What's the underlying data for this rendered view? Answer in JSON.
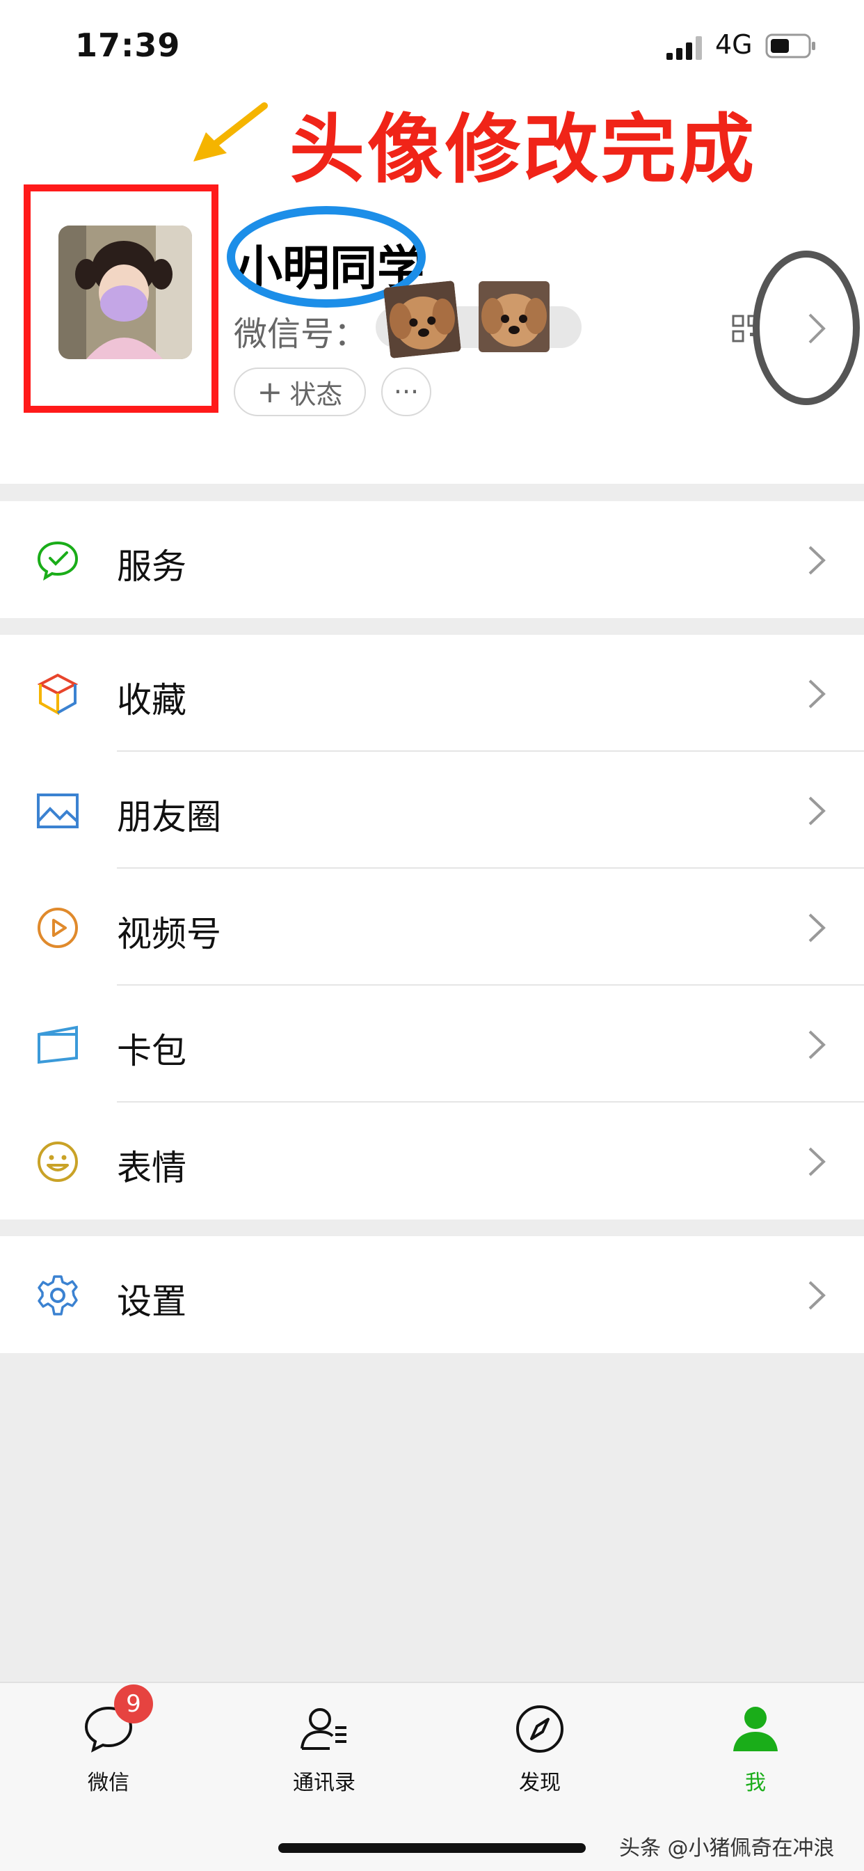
{
  "status_bar": {
    "time": "17:39",
    "network": "4G"
  },
  "annotation": {
    "title": "头像修改完成"
  },
  "profile": {
    "nickname": "小明同学",
    "wechat_id_label": "微信号：",
    "status_button_label": "状态",
    "more_button_label": "···"
  },
  "menu_groups": [
    {
      "items": [
        {
          "label": "服务",
          "icon": "services-icon"
        }
      ]
    },
    {
      "items": [
        {
          "label": "收藏",
          "icon": "favorites-icon"
        },
        {
          "label": "朋友圈",
          "icon": "moments-icon"
        },
        {
          "label": "视频号",
          "icon": "channels-icon"
        },
        {
          "label": "卡包",
          "icon": "card-wallet-icon"
        },
        {
          "label": "表情",
          "icon": "stickers-icon"
        }
      ]
    },
    {
      "items": [
        {
          "label": "设置",
          "icon": "settings-icon"
        }
      ]
    }
  ],
  "tabbar": {
    "tabs": [
      {
        "label": "微信",
        "icon": "chat-icon",
        "badge": "9"
      },
      {
        "label": "通讯录",
        "icon": "contacts-icon"
      },
      {
        "label": "发现",
        "icon": "discover-icon"
      },
      {
        "label": "我",
        "icon": "me-icon",
        "active": true
      }
    ]
  },
  "watermark": "头条 @小猪佩奇在冲浪",
  "colors": {
    "accent_green": "#1aad19",
    "annotation_red": "#f02418",
    "annotation_blue": "#1c8ee8",
    "badge_red": "#e64340"
  }
}
